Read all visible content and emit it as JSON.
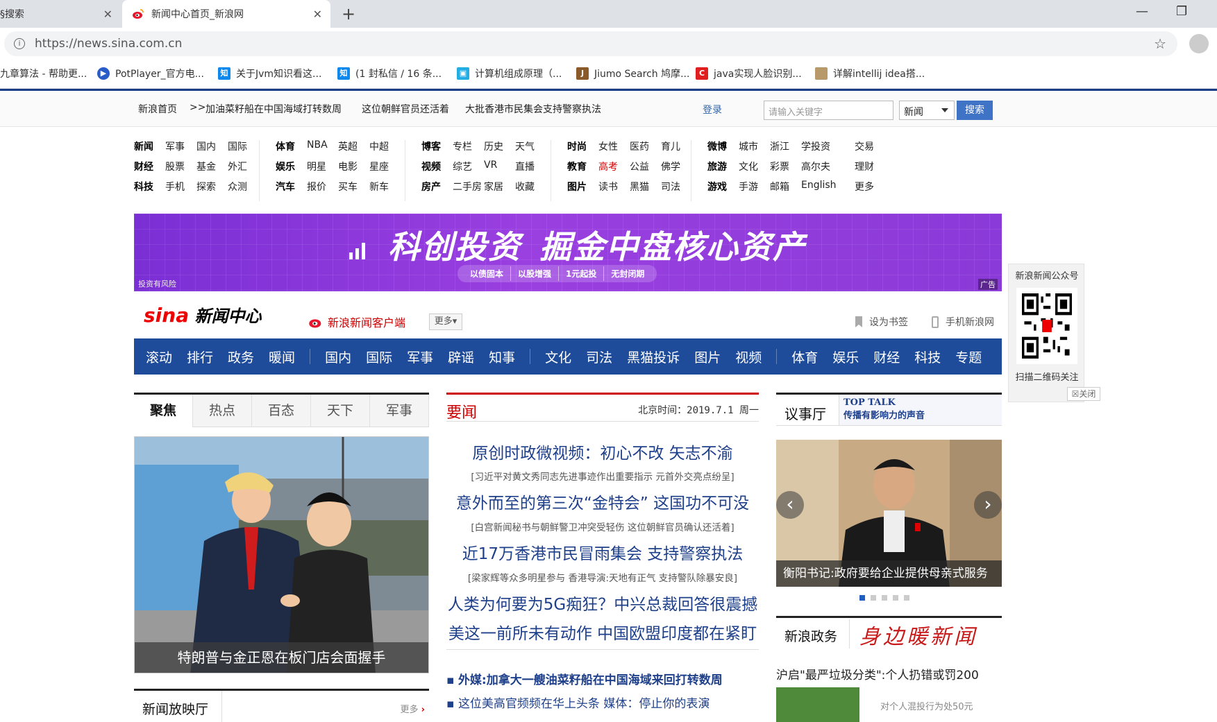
{
  "browser": {
    "tab1_label": "§搜索",
    "tab2_label": "新闻中心首页_新浪网",
    "tab_close": "✕",
    "new_tab": "+",
    "url": "https://news.sina.com.cn",
    "bookmarks": [
      {
        "label": "九章算法 - 帮助更...",
        "icon": "jiuzhang-icon"
      },
      {
        "label": "PotPlayer_官方电...",
        "icon": "potplayer-icon"
      },
      {
        "label": "关于Jvm知识看这...",
        "icon": "zhihu-icon"
      },
      {
        "label": "(1 封私信 / 16 条...",
        "icon": "zhihu-icon"
      },
      {
        "label": "计算机组成原理（...",
        "icon": "bilibili-icon"
      },
      {
        "label": "Jiumo Search 鸠摩...",
        "icon": "jiumo-icon"
      },
      {
        "label": "java实现人脸识别...",
        "icon": "csdn-icon"
      },
      {
        "label": "详解intellij idea搭...",
        "icon": "image-icon"
      }
    ]
  },
  "topbar": {
    "home": "新浪首页",
    "arrow": ">>",
    "links": [
      "加油菜籽船在中国海域打转数周",
      "这位朝鲜官员还活着",
      "大批香港市民集会支持警察执法"
    ],
    "login": "登录",
    "search_placeholder": "请输入关键字",
    "search_scope": "新闻",
    "search_button": "搜索"
  },
  "channels": {
    "g1": [
      [
        "新闻",
        "军事",
        "国内",
        "国际"
      ],
      [
        "财经",
        "股票",
        "基金",
        "外汇"
      ],
      [
        "科技",
        "手机",
        "探索",
        "众测"
      ]
    ],
    "g2": [
      [
        "体育",
        "NBA",
        "英超",
        "中超"
      ],
      [
        "娱乐",
        "明星",
        "电影",
        "星座"
      ],
      [
        "汽车",
        "报价",
        "买车",
        "新车"
      ]
    ],
    "g3": [
      [
        "博客",
        "专栏",
        "历史",
        "天气"
      ],
      [
        "视频",
        "综艺",
        "VR",
        "直播"
      ],
      [
        "房产",
        "二手房",
        "家居",
        "收藏"
      ]
    ],
    "g4": [
      [
        "时尚",
        "女性",
        "医药",
        "育儿"
      ],
      [
        "教育",
        "高考",
        "公益",
        "佛学"
      ],
      [
        "图片",
        "读书",
        "黑猫",
        "司法"
      ]
    ],
    "g5": [
      [
        "微博",
        "城市",
        "浙江",
        "学投资"
      ],
      [
        "旅游",
        "文化",
        "彩票",
        "高尔夫"
      ],
      [
        "游戏",
        "手游",
        "邮箱",
        "English"
      ]
    ],
    "g6": [
      "交易",
      "理财",
      "更多"
    ]
  },
  "banner": {
    "slogan1": "科创投资",
    "slogan2": "掘金中盘核心资产",
    "pills": [
      "以债固本",
      "以股增强",
      "1元起投",
      "无封闭期"
    ],
    "risk": "投资有风险",
    "ad": "广告"
  },
  "qr": {
    "title": "新浪新闻公众号",
    "hint": "扫描二维码关注",
    "close": "关闭"
  },
  "header": {
    "logo_sina": "sina",
    "logo_text": "新闻中心",
    "client": "新浪新闻客户端",
    "more": "更多",
    "bookmark": "设为书签",
    "mobile": "手机新浪网"
  },
  "mainnav": [
    [
      "滚动",
      "排行",
      "政务",
      "暖闻"
    ],
    [
      "国内",
      "国际",
      "军事",
      "辟谣",
      "知事"
    ],
    [
      "文化",
      "司法",
      "黑猫投诉",
      "图片",
      "视频"
    ],
    [
      "体育",
      "娱乐",
      "财经",
      "科技",
      "专题"
    ]
  ],
  "left": {
    "tabs": [
      "聚焦",
      "热点",
      "百态",
      "天下",
      "军事"
    ],
    "photo_caption": "特朗普与金正恩在板门店会面握手",
    "sub_title": "新闻放映厅",
    "sub_more": "更多"
  },
  "middle": {
    "title": "要闻",
    "date": "北京时间：2019.7.1 周一",
    "headlines": [
      "原创时政微视频：初心不改 矢志不渝",
      "[习近平对黄文秀同志先进事迹作出重要指示  元首外交亮点纷呈]",
      "意外而至的第三次“金特会”  这国功不可没",
      "[白宫新闻秘书与朝鲜警卫冲突受轻伤  这位朝鲜官员确认还活着]",
      "近17万香港市民冒雨集会 支持警察执法",
      "[梁家辉等众多明星参与  香港导演:天地有正气  支持警队除暴安良]",
      "人类为何要为5G痴狂？中兴总裁回答很震撼",
      "美这一前所未有动作 中国欧盟印度都在紧盯"
    ],
    "bullets": [
      "外媒:加拿大一艘油菜籽船在中国海域来回打转数周",
      "这位美高官频频在华上头条  媒体：停止你的表演"
    ]
  },
  "right": {
    "title": "议事厅",
    "brand_en": "TOP TALK",
    "brand_cn": "传播有影响力的声音",
    "photo_caption": "衡阳书记:政府要给企业提供母亲式服务",
    "sub_title": "新浪政务",
    "sub_brand": "身边暖新闻",
    "line": "沪启\"最严垃圾分类\":个人扔错或罚200",
    "note": "对个人混投行为处50元"
  }
}
